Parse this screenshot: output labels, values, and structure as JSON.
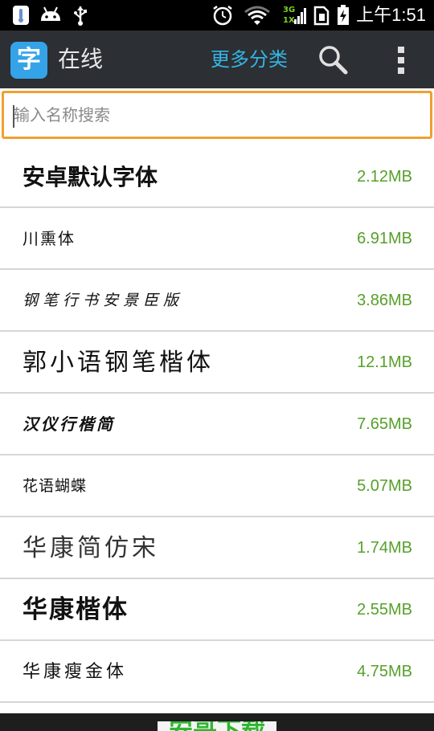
{
  "status_bar": {
    "time": "上午1:51",
    "network": "3G 1X",
    "icons": [
      "thermometer-icon",
      "android-icon",
      "usb-icon",
      "alarm-icon",
      "wifi-icon",
      "signal-icon",
      "sim-icon",
      "battery-icon"
    ]
  },
  "action_bar": {
    "app_icon_glyph": "字",
    "title": "在线",
    "more_categories": "更多分类",
    "icons": [
      "search-icon",
      "overflow-menu-icon"
    ]
  },
  "search": {
    "placeholder": "输入名称搜索",
    "value": ""
  },
  "fonts": [
    {
      "name": "安卓默认字体",
      "size": "2.12MB"
    },
    {
      "name": "川熏体",
      "size": "6.91MB"
    },
    {
      "name": "钢笔行书安景臣版",
      "size": "3.86MB"
    },
    {
      "name": "郭小语钢笔楷体",
      "size": "12.1MB"
    },
    {
      "name": "汉仪行楷简",
      "size": "7.65MB"
    },
    {
      "name": "花语蝴蝶",
      "size": "5.07MB"
    },
    {
      "name": "华康简仿宋",
      "size": "1.74MB"
    },
    {
      "name": "华康楷体",
      "size": "2.55MB"
    },
    {
      "name": "华康瘦金体",
      "size": "4.75MB"
    }
  ],
  "banner": {
    "text": "安哥下载"
  },
  "colors": {
    "accent": "#33b5e5",
    "size_green": "#57a02a",
    "focus_orange": "#f0a030",
    "action_bar": "#2c2f33"
  }
}
